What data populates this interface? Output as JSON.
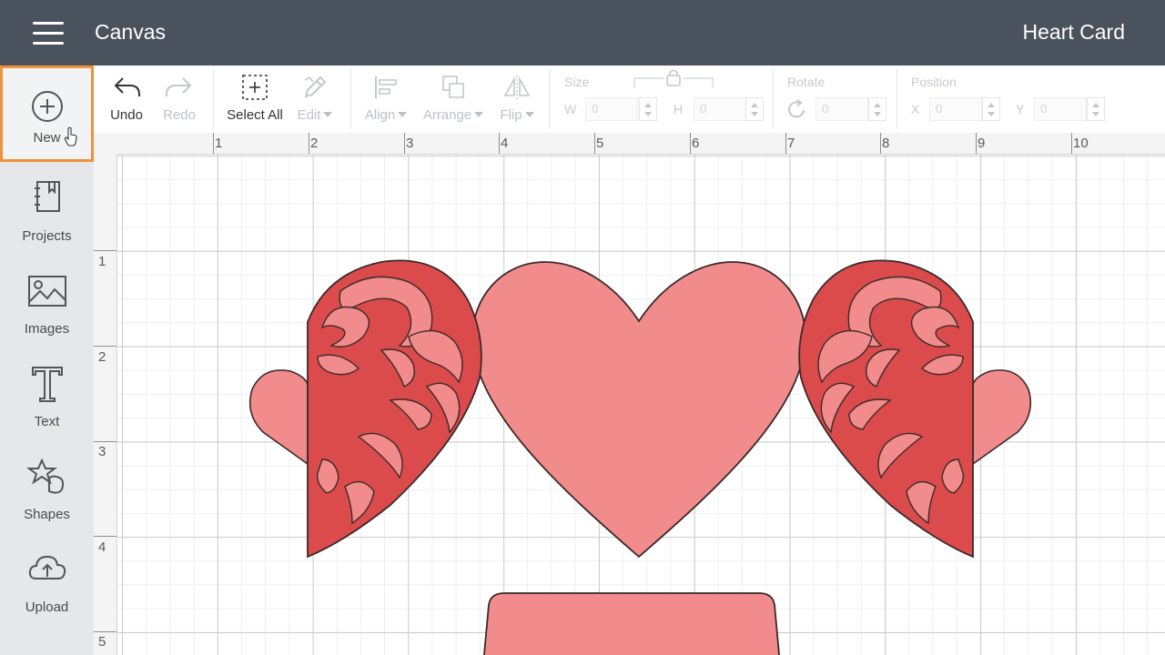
{
  "header": {
    "app_title": "Canvas",
    "document_title": "Heart Card"
  },
  "sidebar": {
    "items": [
      {
        "label": "New",
        "icon": "plus-circle-icon",
        "highlighted": true
      },
      {
        "label": "Projects",
        "icon": "notebook-icon"
      },
      {
        "label": "Images",
        "icon": "image-icon"
      },
      {
        "label": "Text",
        "icon": "text-t-icon"
      },
      {
        "label": "Shapes",
        "icon": "shapes-icon"
      },
      {
        "label": "Upload",
        "icon": "cloud-upload-icon"
      }
    ],
    "highlight_color": "#f0923a"
  },
  "toolbar": {
    "undo": "Undo",
    "redo": "Redo",
    "select_all": "Select All",
    "edit": "Edit",
    "align": "Align",
    "arrange": "Arrange",
    "flip": "Flip",
    "size_label": "Size",
    "w_label": "W",
    "h_label": "H",
    "rotate_label": "Rotate",
    "position_label": "Position",
    "x_label": "X",
    "y_label": "Y",
    "w_value": "0",
    "h_value": "0",
    "rotate_value": "0",
    "x_value": "0",
    "y_value": "0"
  },
  "rulers": {
    "top": [
      "1",
      "2",
      "3",
      "4",
      "5",
      "6",
      "7",
      "8",
      "9",
      "10"
    ],
    "left": [
      "1",
      "2",
      "3",
      "4",
      "5"
    ]
  },
  "colors": {
    "header_bg": "#4a525e",
    "light_pink": "#f28b8b",
    "dark_red": "#dc4b4b",
    "outline": "#3a2a2a"
  }
}
